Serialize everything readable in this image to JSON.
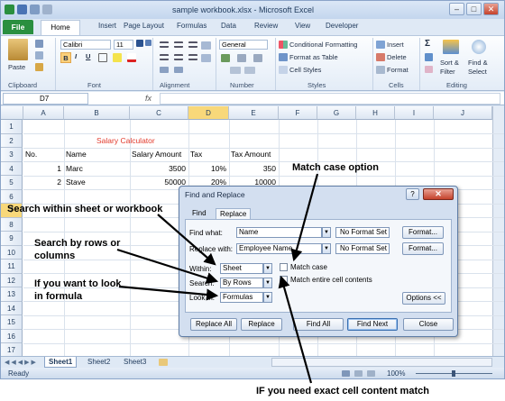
{
  "window": {
    "title": "sample workbook.xlsx - Microsoft Excel"
  },
  "tabs": [
    "File",
    "Home",
    "Insert",
    "Page Layout",
    "Formulas",
    "Data",
    "Review",
    "View",
    "Developer"
  ],
  "ribbon": {
    "paste": "Paste",
    "font_name": "Calibri",
    "font_size": "11",
    "number_format": "General",
    "cond_format": "Conditional Formatting",
    "format_table": "Format as Table",
    "cell_styles": "Cell Styles",
    "insert": "Insert",
    "delete": "Delete",
    "format": "Format",
    "sort_filter": "Sort &",
    "sort_filter2": "Filter",
    "find_select": "Find &",
    "find_select2": "Select",
    "bold": "B",
    "italic": "I",
    "underline": "U",
    "groups": [
      "Clipboard",
      "Font",
      "Alignment",
      "Number",
      "Styles",
      "Cells",
      "Editing"
    ]
  },
  "formula_bar": {
    "name_box": "D7",
    "fx": "fx"
  },
  "grid": {
    "columns": [
      "A",
      "B",
      "C",
      "D",
      "E",
      "F",
      "G",
      "H",
      "I",
      "J"
    ],
    "rows": [
      "1",
      "2",
      "3",
      "4",
      "5",
      "6",
      "7",
      "8",
      "9",
      "10",
      "11",
      "12",
      "13",
      "14",
      "15",
      "16",
      "17"
    ],
    "title": "Salary Calculator",
    "headers": [
      "No.",
      "Name",
      "Salary Amount",
      "Tax",
      "Tax Amount"
    ],
    "data": [
      [
        "1",
        "Marc",
        "3500",
        "10%",
        "350"
      ],
      [
        "2",
        "Stave",
        "50000",
        "20%",
        "10000"
      ]
    ]
  },
  "sheets": [
    "Sheet1",
    "Sheet2",
    "Sheet3"
  ],
  "status": {
    "ready": "Ready",
    "zoom": "100%"
  },
  "dialog": {
    "title": "Find and Replace",
    "tab_find": "Find",
    "tab_replace": "Replace",
    "find_what_label": "Find what:",
    "find_what_value": "Name",
    "replace_with_label": "Replace with:",
    "replace_with_value": "Employee Name",
    "no_format_1": "No Format Set",
    "no_format_2": "No Format Set",
    "format_btn_1": "Format...",
    "format_btn_2": "Format...",
    "within_label": "Within:",
    "within_value": "Sheet",
    "search_label": "Search:",
    "search_value": "By Rows",
    "lookin_label": "Look in:",
    "lookin_value": "Formulas",
    "match_case": "Match case",
    "match_entire": "Match entire cell contents",
    "options_btn": "Options <<",
    "replace_all": "Replace All",
    "replace": "Replace",
    "find_all": "Find All",
    "find_next": "Find Next",
    "close": "Close",
    "help": "?",
    "close_x": "✕"
  },
  "callouts": {
    "match_case": "Match case option",
    "search_within": "Search within sheet or workbook",
    "search_rows_1": "Search by rows or",
    "search_rows_2": "columns",
    "formula_1": "If you want to look",
    "formula_2": "in formula",
    "exact": "IF you need exact cell content match"
  }
}
